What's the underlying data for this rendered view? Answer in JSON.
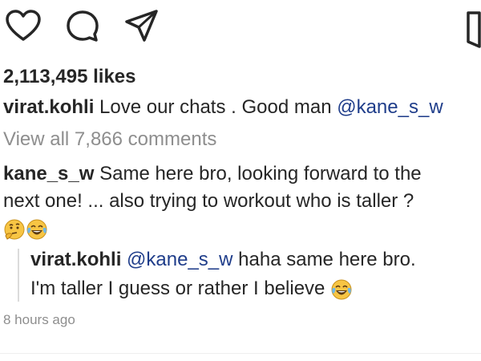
{
  "post": {
    "likes": "2,113,495 likes",
    "caption": {
      "user": "virat.kohli",
      "text": "Love our chats . Good man",
      "mention": "@kane_s_w"
    },
    "view_all": "View all 7,866 comments",
    "comment": {
      "user": "kane_s_w",
      "line1": "Same here bro, looking forward to the",
      "line2": "next one! ... also trying to workout who is taller ?",
      "emojis": [
        "thinking-face",
        "face-with-tears-of-joy"
      ]
    },
    "reply": {
      "user": "virat.kohli",
      "mention": "@kane_s_w",
      "line1_text": "haha same here bro.",
      "line2_text": "I'm taller I guess or rather I believe",
      "emoji": "face-with-tears-of-joy"
    },
    "timestamp": "8 hours ago"
  },
  "icons": {
    "heart": "heart-icon",
    "comment": "comment-icon",
    "share": "share-icon",
    "bookmark": "bookmark-icon"
  },
  "colors": {
    "text": "#262626",
    "muted": "#8e8e8e",
    "mention": "#1f3d8a",
    "emoji_face": "#f7c544"
  }
}
